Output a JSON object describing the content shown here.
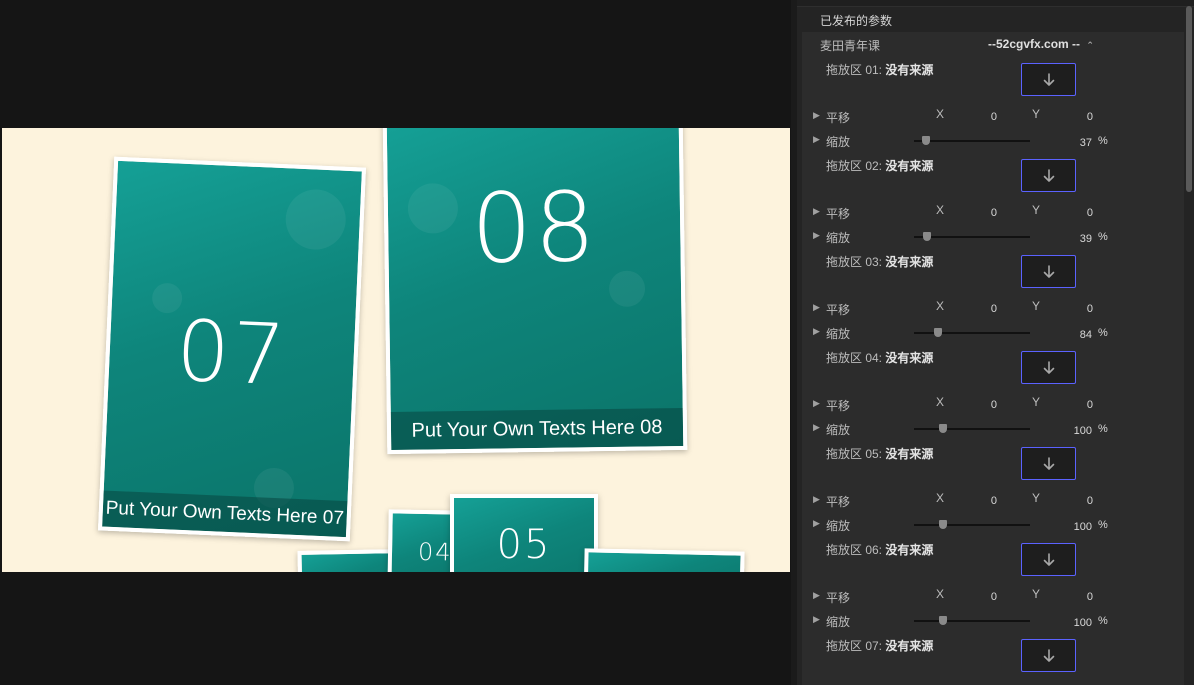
{
  "inspector": {
    "header": "已发布的参数",
    "preset": {
      "label": "麦田青年课",
      "value": "--52cgvfx.com --",
      "chevron": "⌃⌄"
    },
    "dropzones": [
      {
        "label": "拖放区 01:",
        "value": "没有来源"
      },
      {
        "label": "拖放区 02:",
        "value": "没有来源"
      },
      {
        "label": "拖放区 03:",
        "value": "没有来源"
      },
      {
        "label": "拖放区 04:",
        "value": "没有来源"
      },
      {
        "label": "拖放区 05:",
        "value": "没有来源"
      },
      {
        "label": "拖放区 06:",
        "value": "没有来源"
      },
      {
        "label": "拖放区 07:",
        "value": "没有来源"
      }
    ],
    "transforms": [
      {
        "move_label": "平移",
        "x_label": "X",
        "x": "0",
        "y_label": "Y",
        "y": "0",
        "scale_label": "缩放",
        "scale": "37",
        "scale_fraction": 0.1,
        "unit": "%"
      },
      {
        "move_label": "平移",
        "x_label": "X",
        "x": "0",
        "y_label": "Y",
        "y": "0",
        "scale_label": "缩放",
        "scale": "39",
        "scale_fraction": 0.11,
        "unit": "%"
      },
      {
        "move_label": "平移",
        "x_label": "X",
        "x": "0",
        "y_label": "Y",
        "y": "0",
        "scale_label": "缩放",
        "scale": "84",
        "scale_fraction": 0.21,
        "unit": "%"
      },
      {
        "move_label": "平移",
        "x_label": "X",
        "x": "0",
        "y_label": "Y",
        "y": "0",
        "scale_label": "缩放",
        "scale": "100",
        "scale_fraction": 0.25,
        "unit": "%"
      },
      {
        "move_label": "平移",
        "x_label": "X",
        "x": "0",
        "y_label": "Y",
        "y": "0",
        "scale_label": "缩放",
        "scale": "100",
        "scale_fraction": 0.25,
        "unit": "%"
      },
      {
        "move_label": "平移",
        "x_label": "X",
        "x": "0",
        "y_label": "Y",
        "y": "0",
        "scale_label": "缩放",
        "scale": "100",
        "scale_fraction": 0.25,
        "unit": "%"
      }
    ],
    "well_icon": "down-arrow-icon",
    "accent_color": "#5b62ff"
  },
  "viewer": {
    "background": "#fdf3dd",
    "card_color": "#0e857b",
    "cards": [
      {
        "number": "07",
        "caption": "Put Your Own Texts Here 07"
      },
      {
        "number": "08",
        "caption": "Put Your Own Texts Here 08"
      },
      {
        "number": "04"
      },
      {
        "number": "05"
      }
    ]
  }
}
